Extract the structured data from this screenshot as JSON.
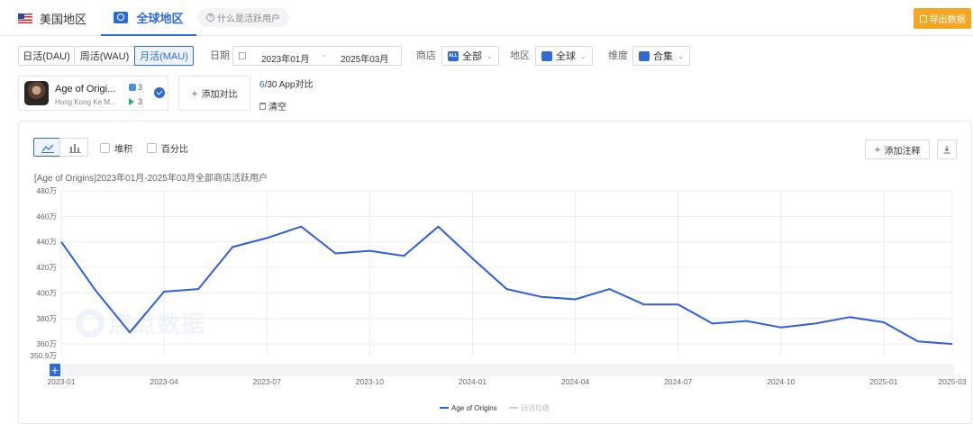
{
  "header": {
    "region_us": "美国地区",
    "region_global": "全球地区",
    "help": "什么是活跃用户",
    "export": "导出数据"
  },
  "filters": {
    "metric_tabs": [
      "日活(DAU)",
      "周活(WAU)",
      "月活(MAU)"
    ],
    "active_metric": "月活(MAU)",
    "date_label": "日期",
    "date_start": "2023年01月",
    "date_sep": "-",
    "date_end": "2025年03月",
    "store_label": "商店",
    "store_badge": "ALL",
    "store_value": "全部",
    "region_label": "地区",
    "region_value": "全球",
    "dimension_label": "维度",
    "dimension_value": "合集"
  },
  "app": {
    "name": "Age of Origi...",
    "developer": "Hong Kong Ke M...",
    "ios_count": "3",
    "gp_count": "3",
    "add_compare": "添加对比",
    "compare_used": "6",
    "compare_total": "/30 App对比",
    "clear": "清空"
  },
  "chart_controls": {
    "stack": "堆积",
    "percent": "百分比",
    "add_annotation": "添加注释"
  },
  "watermark": "点点数据",
  "colors": {
    "accent": "#2f6bd8",
    "line": "#2f5fd8",
    "export": "#f5a623"
  },
  "chart_data": {
    "type": "line",
    "title": "[Age of Origins]2023年01月-2025年03月全部商店活跃用户",
    "y_ticks": [
      "480万",
      "460万",
      "440万",
      "420万",
      "400万",
      "380万",
      "360万",
      "350.9万"
    ],
    "y_tick_values": [
      480,
      460,
      440,
      420,
      400,
      380,
      360,
      350.9
    ],
    "ylim": [
      350.9,
      480
    ],
    "x_ticks": [
      "2023-01",
      "2023-04",
      "2023-07",
      "2023-10",
      "2024-01",
      "2024-04",
      "2024-07",
      "2024-10",
      "2025-01",
      "2025-03"
    ],
    "series": [
      {
        "name": "Age of Origins",
        "x": [
          "2023-01",
          "2023-02",
          "2023-03",
          "2023-04",
          "2023-05",
          "2023-06",
          "2023-07",
          "2023-08",
          "2023-09",
          "2023-10",
          "2023-11",
          "2023-12",
          "2024-01",
          "2024-02",
          "2024-03",
          "2024-04",
          "2024-05",
          "2024-06",
          "2024-07",
          "2024-08",
          "2024-09",
          "2024-10",
          "2024-11",
          "2024-12",
          "2025-01",
          "2025-02",
          "2025-03"
        ],
        "values": [
          440,
          402,
          369,
          401,
          403,
          436,
          443,
          452,
          431,
          433,
          429,
          452,
          427,
          403,
          397,
          395,
          403,
          391,
          391,
          376,
          378,
          373,
          376,
          381,
          377,
          362,
          360
        ]
      }
    ],
    "legend": [
      "Age of Origins",
      "日活均值"
    ],
    "grid": true
  }
}
